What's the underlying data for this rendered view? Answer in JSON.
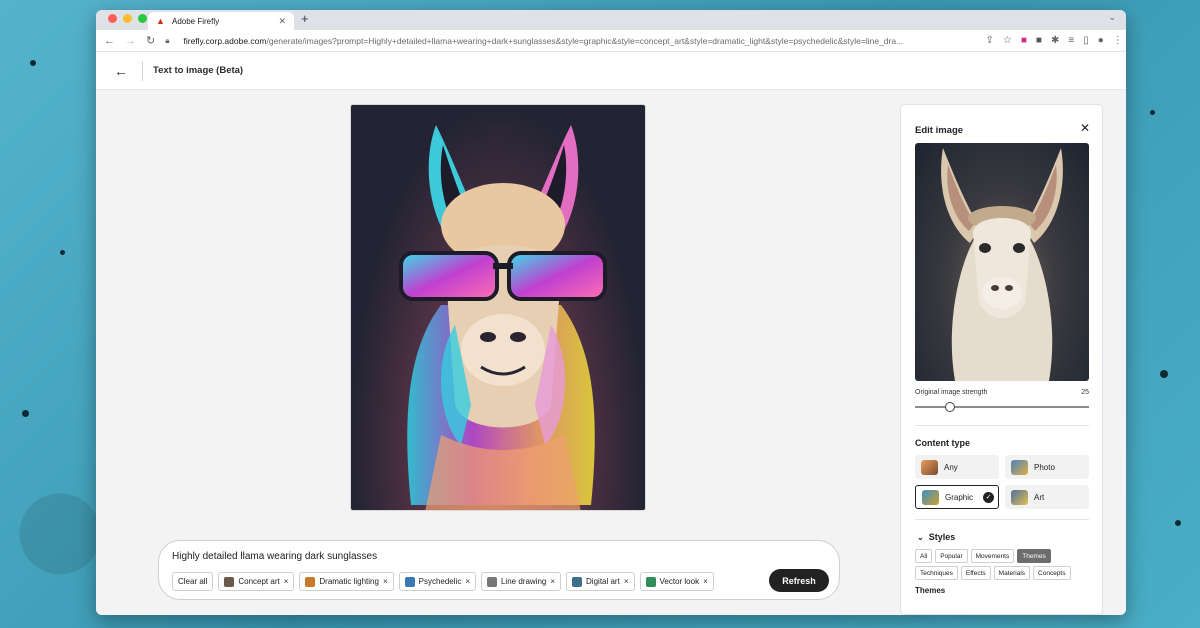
{
  "browser": {
    "tab_title": "Adobe Firefly",
    "url_host": "firefly.corp.adobe.com",
    "url_rest": "/generate/images?prompt=Highly+detailed+llama+wearing+dark+sunglasses&style=graphic&style=concept_art&style=dramatic_light&style=psychedelic&style=line_dra...",
    "new_tab": "+",
    "tab_close": "✕"
  },
  "app": {
    "back_label": "←",
    "title": "Text to image (Beta)"
  },
  "prompt": {
    "text": "Highly detailed llama wearing dark sunglasses",
    "clear_all": "Clear all",
    "chips": [
      {
        "label": "Concept art",
        "remove": "×",
        "color": "#6b5a4a"
      },
      {
        "label": "Dramatic lighting",
        "remove": "×",
        "color": "#c77a2a"
      },
      {
        "label": "Psychedelic",
        "remove": "×",
        "color": "#3a78b5"
      },
      {
        "label": "Line drawing",
        "remove": "×",
        "color": "#777777"
      },
      {
        "label": "Digital art",
        "remove": "×",
        "color": "#3d6e8a"
      },
      {
        "label": "Vector look",
        "remove": "×",
        "color": "#2f8d5a"
      }
    ],
    "refresh": "Refresh"
  },
  "panel": {
    "title": "Edit image",
    "close": "✕",
    "strength_label": "Original image strength",
    "strength_value": "25",
    "strength_fraction": 0.2,
    "content_type_title": "Content type",
    "content_types": [
      {
        "label": "Any",
        "selected": false
      },
      {
        "label": "Photo",
        "selected": false
      },
      {
        "label": "Graphic",
        "selected": true
      },
      {
        "label": "Art",
        "selected": false
      }
    ],
    "styles_title": "Styles",
    "style_tabs_row1": [
      "All",
      "Popular",
      "Movements",
      "Themes"
    ],
    "style_tabs_row2": [
      "Techniques",
      "Effects",
      "Materials",
      "Concepts"
    ],
    "selected_tab": "Themes",
    "themes_heading": "Themes"
  },
  "colors": {
    "accent_dark": "#222222",
    "traffic_red": "#ff5f57",
    "traffic_yellow": "#febc2e",
    "traffic_green": "#28c840"
  }
}
